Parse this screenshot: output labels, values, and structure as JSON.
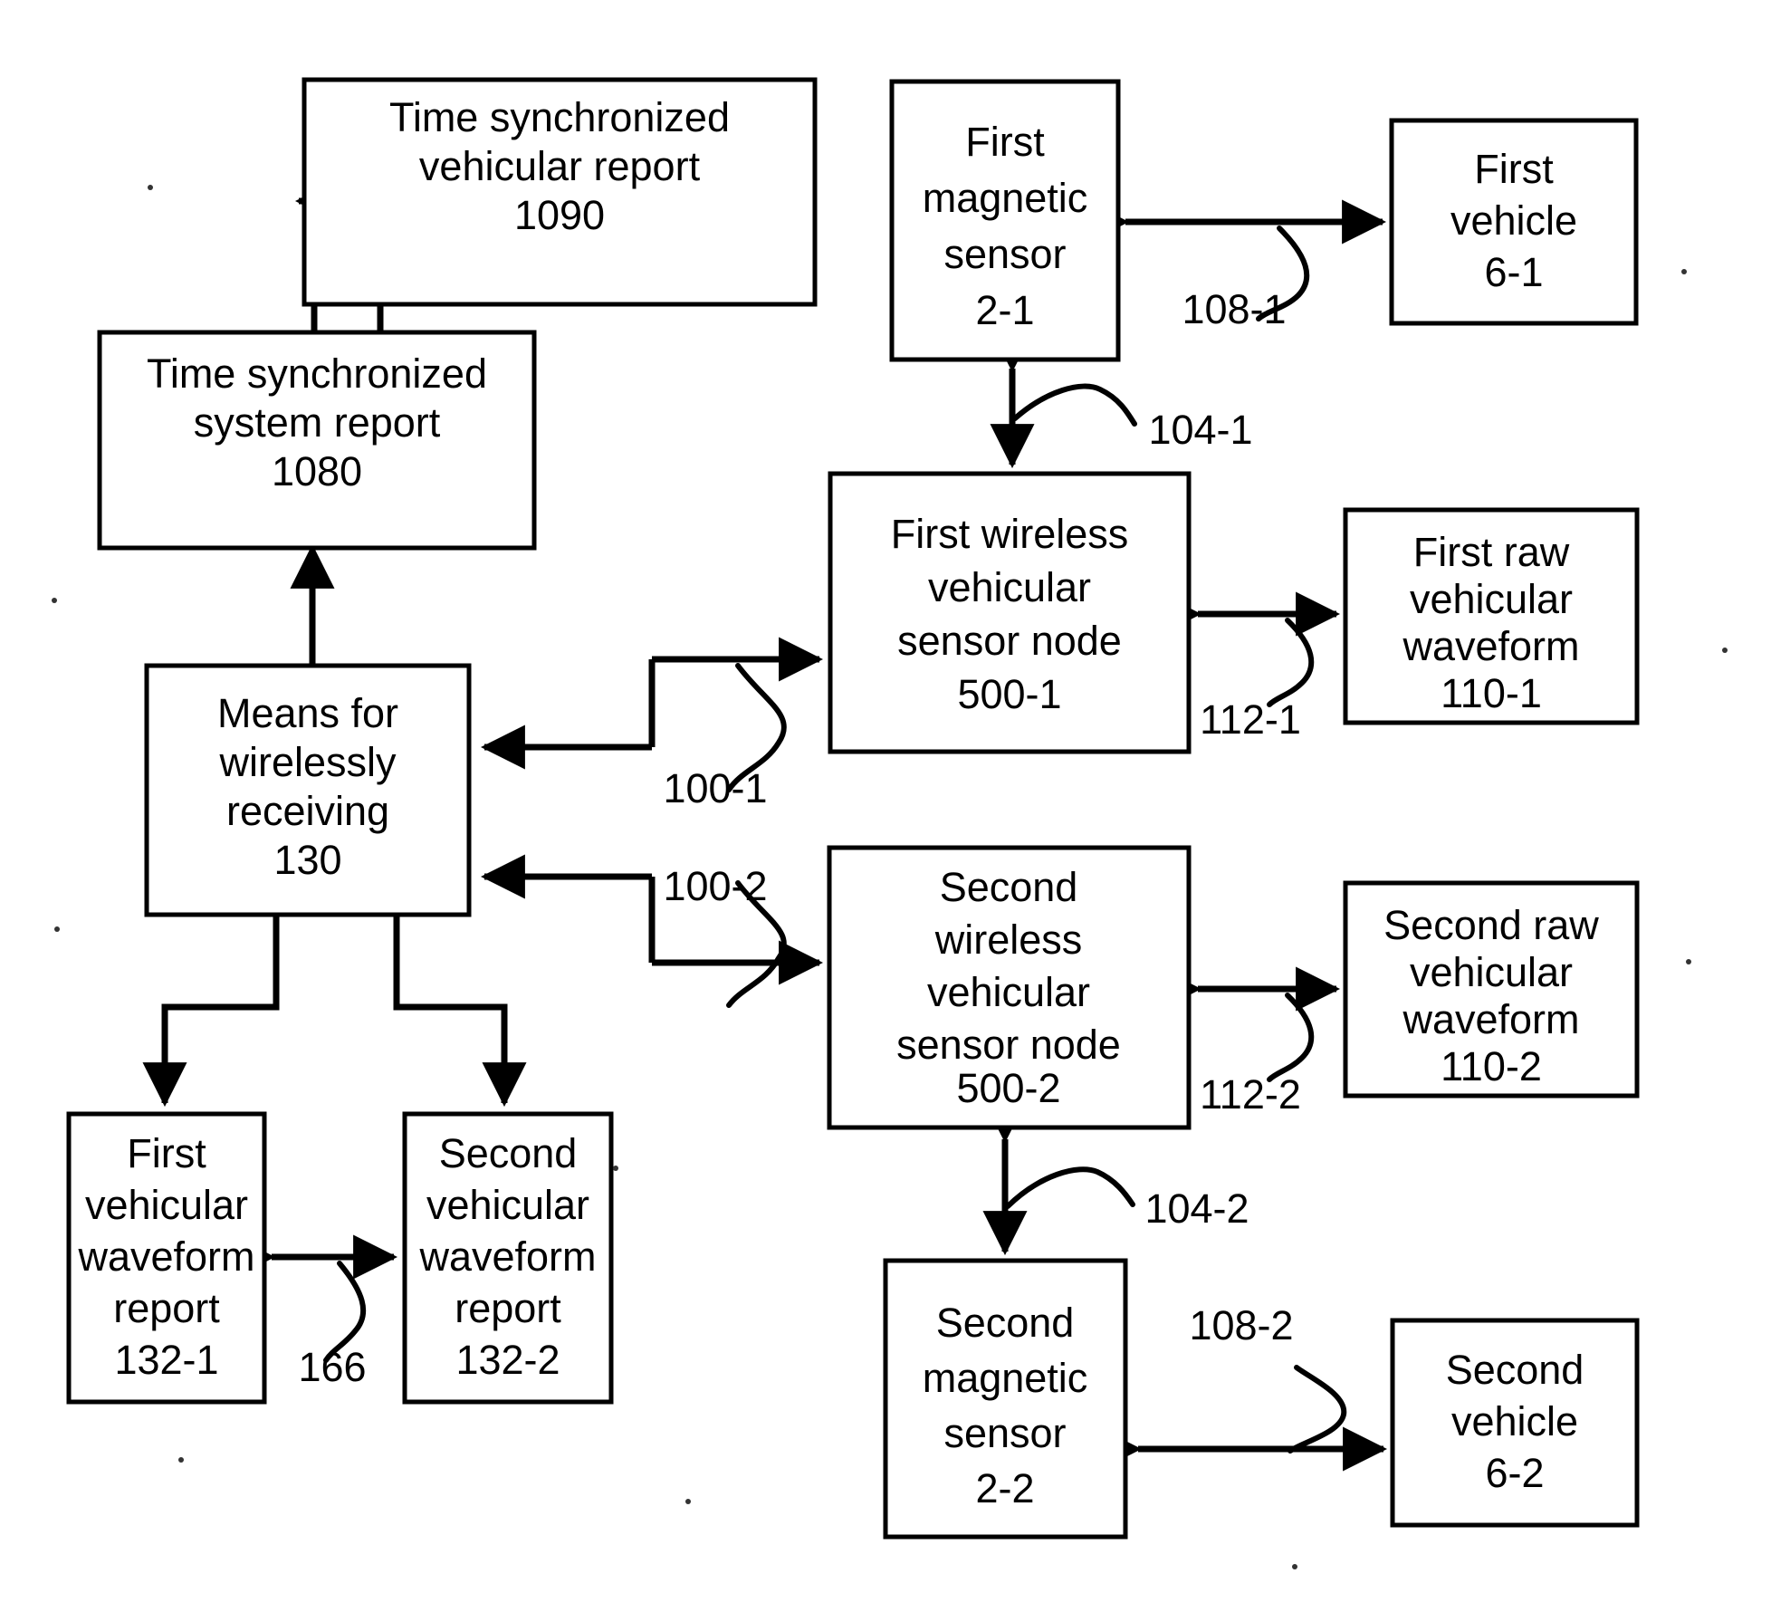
{
  "figure": {
    "type": "patent-block-diagram",
    "background_color": "#ffffff",
    "line_color": "#000000",
    "boxes": [
      {
        "id": "report_1090",
        "lines": [
          "Time synchronized",
          "vehicular report",
          "1090"
        ]
      },
      {
        "id": "report_1080",
        "lines": [
          "Time synchronized",
          "system report",
          "1080"
        ]
      },
      {
        "id": "means_130",
        "lines": [
          "Means for",
          "wirelessly",
          "receiving",
          "130"
        ]
      },
      {
        "id": "magnetic_sensor_1",
        "lines": [
          "First",
          "magnetic",
          "sensor",
          "2-1"
        ]
      },
      {
        "id": "vehicle_1",
        "lines": [
          "First",
          "vehicle",
          "6-1"
        ]
      },
      {
        "id": "node_500_1",
        "lines": [
          "First wireless",
          "vehicular",
          "sensor node",
          "500-1"
        ]
      },
      {
        "id": "raw_waveform_110_1",
        "lines": [
          "First raw",
          "vehicular",
          "waveform",
          "110-1"
        ]
      },
      {
        "id": "node_500_2",
        "lines": [
          "Second",
          "wireless",
          "vehicular",
          "sensor node",
          "500-2"
        ]
      },
      {
        "id": "raw_waveform_110_2",
        "lines": [
          "Second raw",
          "vehicular",
          "waveform",
          "110-2"
        ]
      },
      {
        "id": "waveform_report_132_1",
        "lines": [
          "First",
          "vehicular",
          "waveform",
          "report",
          "132-1"
        ]
      },
      {
        "id": "waveform_report_132_2",
        "lines": [
          "Second",
          "vehicular",
          "waveform",
          "report",
          "132-2"
        ]
      },
      {
        "id": "magnetic_sensor_2",
        "lines": [
          "Second",
          "magnetic",
          "sensor",
          "2-2"
        ]
      },
      {
        "id": "vehicle_2",
        "lines": [
          "Second",
          "vehicle",
          "6-2"
        ]
      }
    ],
    "connector_labels": [
      {
        "id": "label_108_1",
        "text": "108-1"
      },
      {
        "id": "label_104_1",
        "text": "104-1"
      },
      {
        "id": "label_112_1",
        "text": "112-1"
      },
      {
        "id": "label_100_1",
        "text": "100-1"
      },
      {
        "id": "label_100_2",
        "text": "100-2"
      },
      {
        "id": "label_112_2",
        "text": "112-2"
      },
      {
        "id": "label_104_2",
        "text": "104-2"
      },
      {
        "id": "label_108_2",
        "text": "108-2"
      },
      {
        "id": "label_166",
        "text": "166"
      }
    ]
  }
}
